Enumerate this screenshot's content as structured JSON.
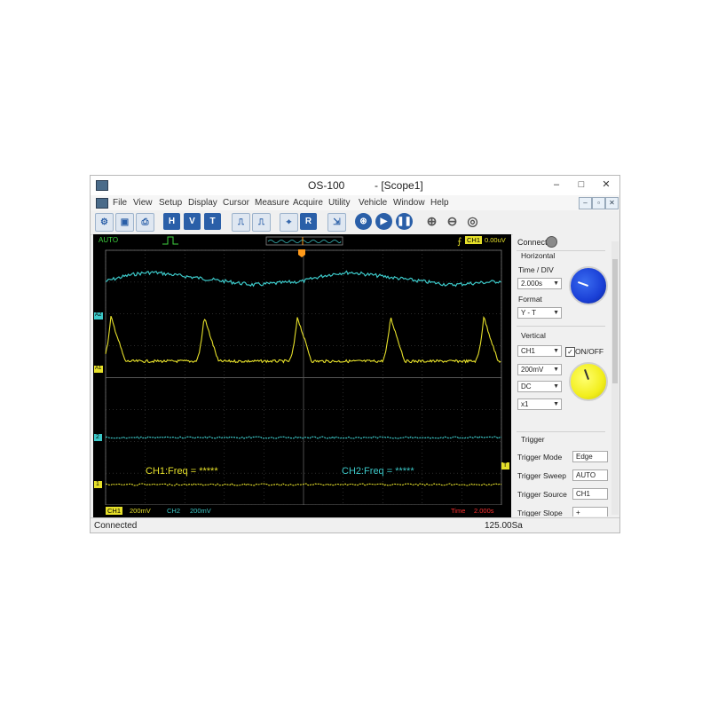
{
  "window": {
    "title": "OS-100",
    "document": "- [Scope1]",
    "minimize": "–",
    "maximize": "□",
    "close": "✕"
  },
  "menu": [
    "File",
    "View",
    "Setup",
    "Display",
    "Cursor",
    "Measure",
    "Acquire",
    "Utility",
    "Vehicle",
    "Window",
    "Help"
  ],
  "toolbar": {
    "h_label": "H",
    "v_label": "V",
    "t_label": "T",
    "r_label": "R"
  },
  "scope": {
    "mode": "AUTO",
    "trigger_channel": "CH1",
    "trigger_level": "0.00uV",
    "ch1_freq": "CH1:Freq = *****",
    "ch2_freq": "CH2:Freq = *****",
    "ch1_scale": "CH1",
    "ch1_volts": "200mV",
    "ch2_scale": "CH2",
    "ch2_volts": "200mV",
    "time_label": "Time",
    "time_value": "2.000s",
    "marker_a2": "A2",
    "marker_a1": "A1",
    "marker_2": "2",
    "marker_1": "1",
    "marker_t": "T",
    "colors": {
      "ch1": "#e6e02a",
      "ch2": "#3cc8c8",
      "grid": "#555555",
      "time": "#ff3030"
    }
  },
  "panel": {
    "connect_label": "Connect",
    "horizontal_title": "Horizontal",
    "time_div_label": "Time / DIV",
    "time_div_value": "2.000s",
    "format_label": "Format",
    "format_value": "Y - T",
    "vertical_title": "Vertical",
    "channel_value": "CH1",
    "onoff_label": "ON/OFF",
    "volts_value": "200mV",
    "coupling_value": "DC",
    "probe_value": "x1",
    "trigger_title": "Trigger",
    "trigger_mode_label": "Trigger Mode",
    "trigger_mode_value": "Edge",
    "trigger_sweep_label": "Trigger Sweep",
    "trigger_sweep_value": "AUTO",
    "trigger_source_label": "Trigger Source",
    "trigger_source_value": "CH1",
    "trigger_slope_label": "Trigger Slope",
    "trigger_slope_value": "+",
    "knob_colors": {
      "horizontal": "#1a3fd6",
      "vertical": "#f2ee1c"
    }
  },
  "status": {
    "left": "Connected",
    "right": "125.00Sa"
  }
}
